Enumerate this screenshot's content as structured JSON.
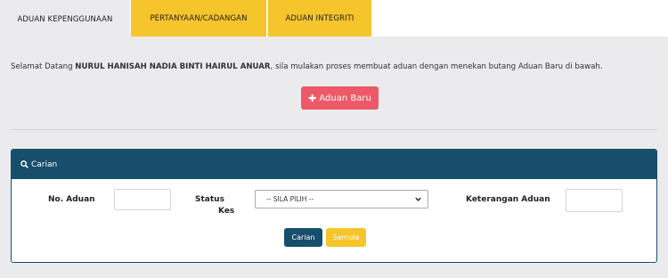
{
  "tabs": [
    {
      "label": "ADUAN KEPENGGUNAAN"
    },
    {
      "label": "PERTANYAAN/CADANGAN"
    },
    {
      "label": "ADUAN INTEGRITI"
    }
  ],
  "welcome": {
    "prefix": "Selamat Datang ",
    "name": "NURUL HANISAH NADIA BINTI HAIRUL ANUAR",
    "suffix": ", sila mulakan proses membuat aduan dengan menekan butang Aduan Baru di bawah."
  },
  "new_button": {
    "label": "Aduan Baru"
  },
  "search_panel": {
    "title": "Carian",
    "fields": {
      "no_aduan_label": "No. Aduan",
      "status_label_1": "Status",
      "status_label_2": "Kes",
      "status_selected": "-- SILA PILIH --",
      "keterangan_label": "Keterangan Aduan"
    },
    "buttons": {
      "search": "Carian",
      "reset": "Semula"
    }
  },
  "colors": {
    "tab_accent": "#f6c42b",
    "primary": "#174e6c",
    "danger": "#ee5968",
    "page_bg": "#ebebed"
  }
}
